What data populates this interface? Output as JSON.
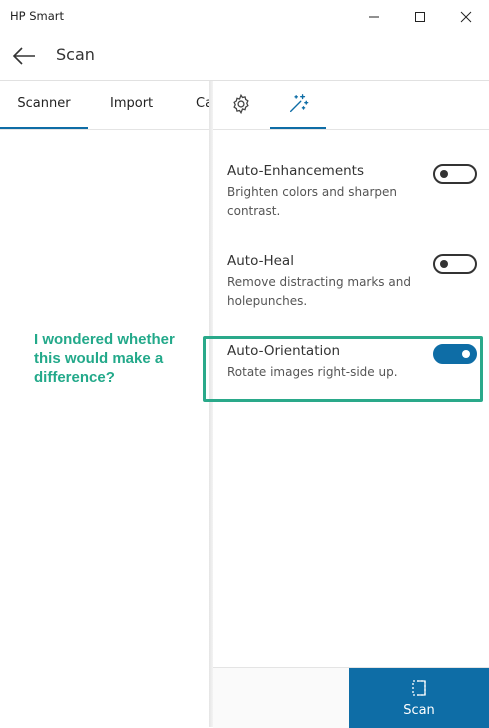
{
  "window": {
    "title": "HP Smart"
  },
  "header": {
    "title": "Scan"
  },
  "left_tabs": [
    {
      "label": "Scanner",
      "active": true
    },
    {
      "label": "Import",
      "active": false
    },
    {
      "label": "Ca",
      "active": false
    }
  ],
  "right_tabs": [
    {
      "icon": "gear-icon",
      "active": false
    },
    {
      "icon": "magic-wand-icon",
      "active": true
    }
  ],
  "settings": [
    {
      "title": "Auto-Enhancements",
      "description": "Brighten colors and sharpen contrast.",
      "enabled": false
    },
    {
      "title": "Auto-Heal",
      "description": "Remove distracting marks and holepunches.",
      "enabled": false
    },
    {
      "title": "Auto-Orientation",
      "description": "Rotate images right-side up.",
      "enabled": true
    }
  ],
  "annotation": {
    "text": "I wondered whether this would make a difference?"
  },
  "bottom_bar": {
    "scan_label": "Scan"
  },
  "colors": {
    "accent": "#0e6da6",
    "annotation": "#23a98a"
  }
}
